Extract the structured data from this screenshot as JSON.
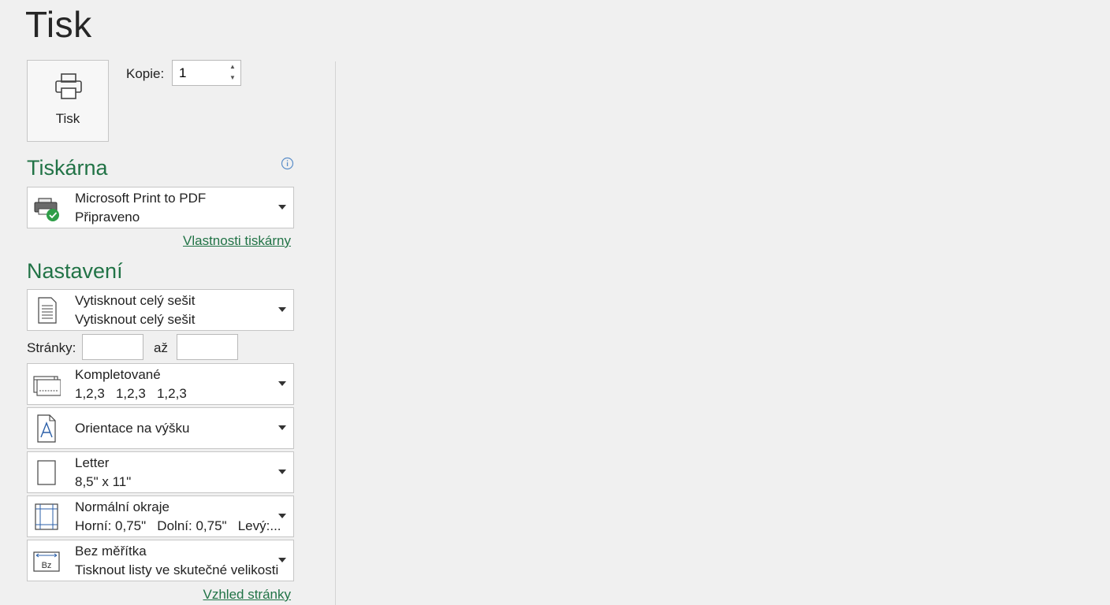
{
  "page_title": "Tisk",
  "print_button": {
    "label": "Tisk",
    "icon": "printer-icon"
  },
  "copies": {
    "label": "Kopie:",
    "value": "1"
  },
  "printer_section": {
    "heading": "Tiskárna",
    "selected": {
      "name": "Microsoft Print to PDF",
      "status": "Připraveno",
      "icon": "printer-ready-icon"
    },
    "properties_link": "Vlastnosti tiskárny"
  },
  "settings_section": {
    "heading": "Nastavení",
    "print_what": {
      "line1": "Vytisknout celý sešit",
      "line2": "Vytisknout celý sešit"
    },
    "pages": {
      "label": "Stránky:",
      "to_label": "až",
      "from_value": "",
      "to_value": ""
    },
    "collation": {
      "line1": "Kompletované",
      "line2": "1,2,3   1,2,3   1,2,3"
    },
    "orientation": {
      "label": "Orientace na výšku"
    },
    "paper": {
      "line1": "Letter",
      "line2": "8,5\" x 11\""
    },
    "margins": {
      "line1": "Normální okraje",
      "line2": "Horní: 0,75\"   Dolní: 0,75\"   Levý:..."
    },
    "scaling": {
      "line1": "Bez měřítka",
      "line2": "Tisknout listy ve skutečné velikosti",
      "icon_text": "Bz"
    },
    "page_setup_link": "Vzhled stránky"
  },
  "colors": {
    "accent": "#217346",
    "background": "#f0f0f0",
    "ready": "#2e9e48"
  }
}
